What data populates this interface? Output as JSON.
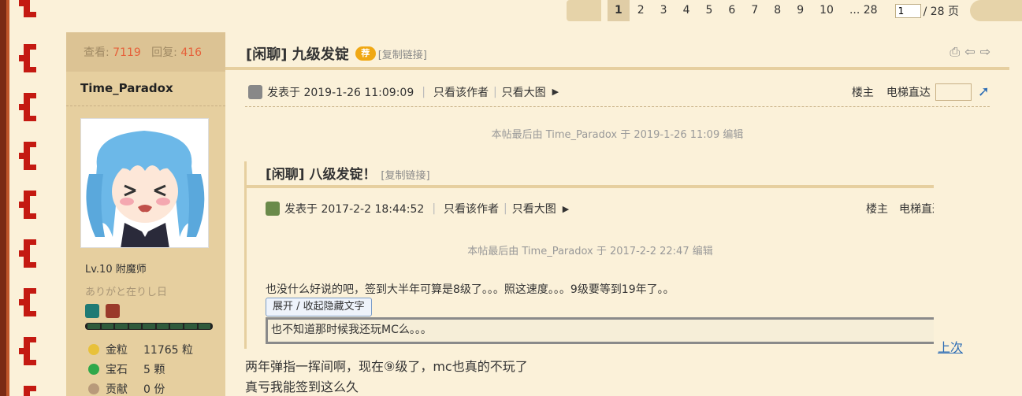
{
  "pager": {
    "pages": [
      "1",
      "2",
      "3",
      "4",
      "5",
      "6",
      "7",
      "8",
      "9",
      "10",
      "... 28"
    ],
    "current": "1",
    "input_value": "1",
    "total": "/ 28 页"
  },
  "author": {
    "views_label": "查看:",
    "views": "7119",
    "replies_label": "回复:",
    "replies": "416",
    "name": "Time_Paradox",
    "level": "Lv.10 附魔师",
    "motto": "ありがと在りし日",
    "attrs": [
      {
        "label": "金粒",
        "value": "11765 粒",
        "icon": "gold-nugget-icon",
        "color": "#e8c13a"
      },
      {
        "label": "宝石",
        "value": "5 颗",
        "icon": "emerald-icon",
        "color": "#2fa84a"
      },
      {
        "label": "贡献",
        "value": "0 份",
        "icon": "contribution-icon",
        "color": "#b89a7a"
      }
    ]
  },
  "post": {
    "title": "[闲聊] 九级发锭",
    "badge": "荐",
    "copy_link": "[复制链接]",
    "posted": "发表于 2019-1-26 11:09:09",
    "only_author": "只看该作者",
    "big_images": "只看大图",
    "floor": "楼主",
    "elevator": "电梯直达",
    "edited": "本帖最后由 Time_Paradox 于 2019-1-26 11:09 编辑",
    "body_line1": "两年弹指一挥间啊，现在⑨级了，mc也真的不玩了",
    "body_line2": "真亏我能签到这么久"
  },
  "quote": {
    "title": "[闲聊] 八级发锭！",
    "copy_link": "[复制链接]",
    "posted": "发表于 2017-2-2 18:44:52",
    "only_author": "只看该作者",
    "big_images": "只看大图",
    "floor": "楼主",
    "elevator": "电梯直达",
    "edited": "本帖最后由 Time_Paradox 于 2017-2-2 22:47 编辑",
    "body": "也没什么好说的吧，签到大半年可算是8级了。。。照这速度。。。9级要等到19年了。。",
    "toggle_label": "展开 / 收起隐藏文字",
    "hidden_text": "也不知道那时候我还玩MC么。。。"
  },
  "last_link": "上次"
}
